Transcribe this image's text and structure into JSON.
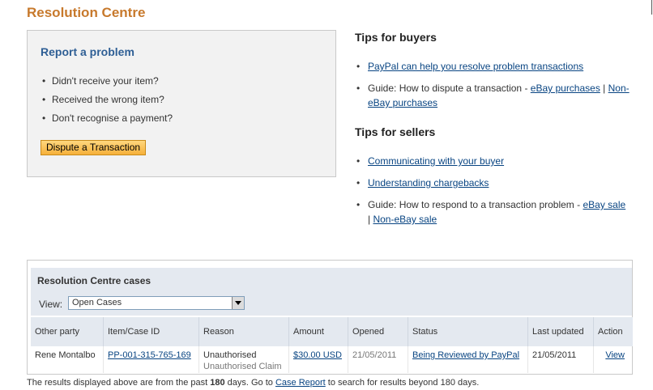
{
  "page": {
    "title": "Resolution Centre"
  },
  "report": {
    "title": "Report a problem",
    "items": [
      "Didn't receive your item?",
      "Received the wrong item?",
      "Don't recognise a payment?"
    ],
    "button_label": "Dispute a Transaction"
  },
  "buyers": {
    "title": "Tips for buyers",
    "link1": "PayPal can help you resolve problem transactions",
    "guide_prefix": "Guide: How to dispute a transaction - ",
    "guide_link1": "eBay purchases",
    "guide_sep": " | ",
    "guide_link2": "Non-eBay purchases"
  },
  "sellers": {
    "title": "Tips for sellers",
    "link1": "Communicating with your buyer",
    "link2": "Understanding chargebacks",
    "guide_prefix": "Guide: How to respond to a transaction problem - ",
    "guide_link1": "eBay sale",
    "guide_sep": " | ",
    "guide_link2": "Non-eBay sale"
  },
  "cases": {
    "title": "Resolution Centre cases",
    "view_label": "View:",
    "view_value": "Open Cases",
    "columns": [
      "Other party",
      "Item/Case ID",
      "Reason",
      "Amount",
      "Opened",
      "Status",
      "Last updated",
      "Action"
    ],
    "row": {
      "other_party": "Rene Montalbo",
      "case_id": "PP-001-315-765-169",
      "reason": "Unauthorised",
      "reason_sub": "Unauthorised Claim",
      "amount": "$30.00 USD",
      "opened": "21/05/2011",
      "status": "Being Reviewed by PayPal",
      "last_updated": "21/05/2011",
      "action": "View"
    }
  },
  "footnote": {
    "prefix": "The results displayed above are from the past ",
    "days": "180",
    "middle": " days. Go to ",
    "link": "Case Report",
    "suffix": " to search for results beyond 180 days."
  },
  "colors": {
    "title": "#c7792c",
    "heading": "#2f5f95",
    "link": "#084482",
    "button": "#f6b03a"
  }
}
